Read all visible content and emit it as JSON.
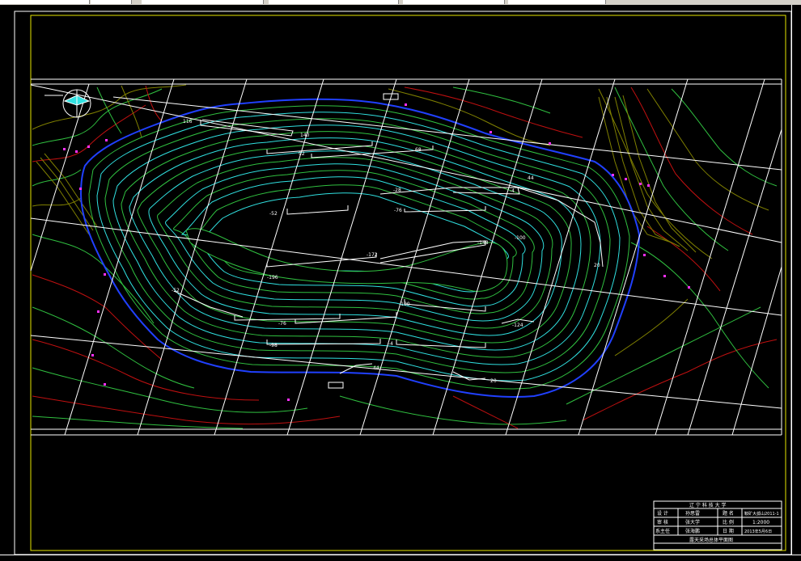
{
  "map": {
    "contours_top_labels": [
      "116",
      "140",
      "92",
      "68",
      "44",
      "-4",
      "-28",
      "-52",
      "-76",
      "-100",
      "-148",
      "-172",
      "-196",
      "-124",
      "20",
      "-76",
      "-98",
      "-4",
      "-100",
      "44",
      "20"
    ],
    "label_top": "116",
    "label_140": "140",
    "label_92": "92",
    "label_68": "68",
    "label_44a": "44",
    "label_neg4a": "-4",
    "label_neg28": "-28",
    "label_neg52": "-52",
    "label_neg76a": "-76",
    "label_neg100a": "-100",
    "label_neg148": "-148",
    "label_neg172": "-172",
    "label_neg196": "-196",
    "label_neg124": "-124",
    "label_20a": "20",
    "label_neg52b": "-52",
    "label_neg76b": "-76",
    "label_neg98": "-98",
    "label_neg4b": "-4",
    "label_neg100b": "-100",
    "label_44b": "44",
    "label_20b": "20",
    "label_20c": "20"
  },
  "title_block": {
    "university": "辽 宁 科 技 大 学",
    "row1": [
      "设 计",
      "孙思雷",
      "题 名",
      "鞍矿大孤山2011-1"
    ],
    "row2": [
      "审 核",
      "张大学",
      "比 例",
      "1:2000"
    ],
    "row3": [
      "系主任",
      "张海鹏",
      "日 期",
      "2013年5月6日"
    ],
    "footer": "露天采场总体平面图"
  },
  "colors": {
    "frame_yellow": "#e6e600",
    "pit_outline": "#2040ff",
    "contour_cyan": "#30e0e0",
    "contour_green": "#30c040",
    "terrain_red": "#c01010",
    "terrain_olive": "#808000",
    "grid_white": "#ffffff",
    "marker_magenta": "#ff30ff"
  }
}
